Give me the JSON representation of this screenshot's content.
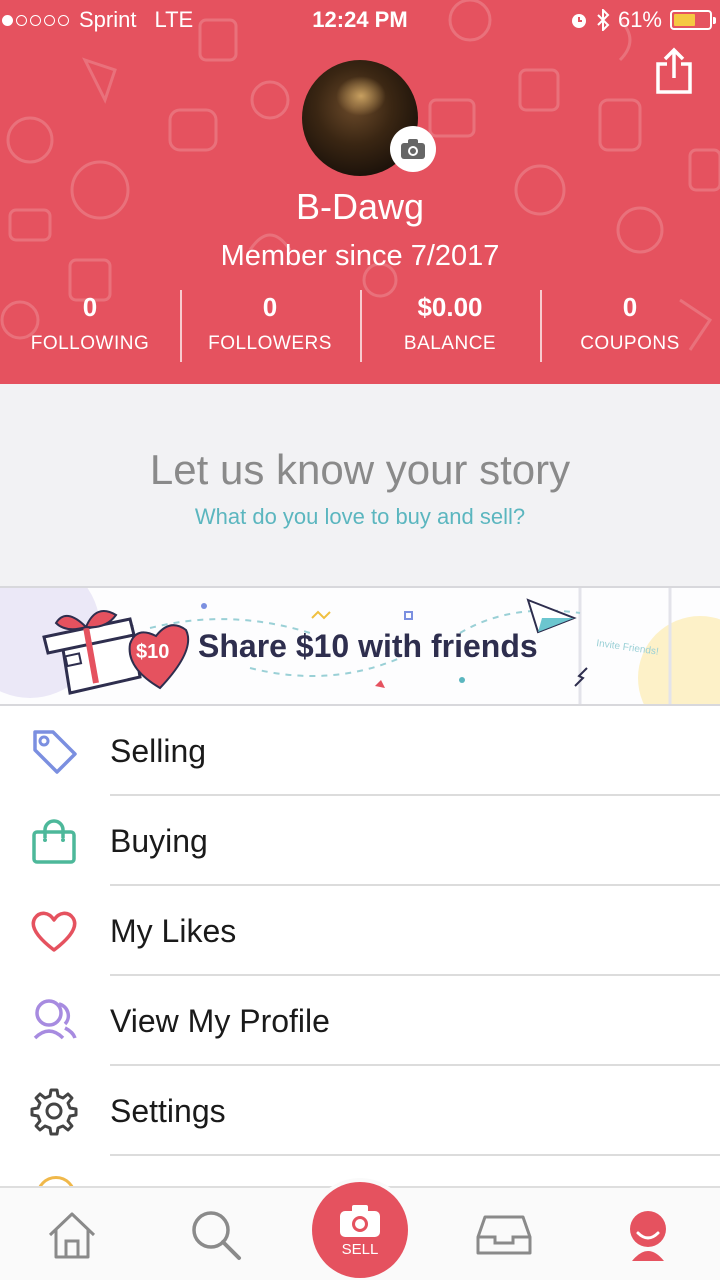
{
  "status_bar": {
    "carrier": "Sprint",
    "network": "LTE",
    "time": "12:24 PM",
    "battery": "61%",
    "battery_level": 0.61,
    "signal_bars": 1
  },
  "profile": {
    "username": "B-Dawg",
    "member_since": "Member since 7/2017",
    "stats": [
      {
        "value": "0",
        "label": "FOLLOWING"
      },
      {
        "value": "0",
        "label": "FOLLOWERS"
      },
      {
        "value": "$0.00",
        "label": "BALANCE"
      },
      {
        "value": "0",
        "label": "COUPONS"
      }
    ]
  },
  "story": {
    "title": "Let us know your story",
    "subtitle": "What do you love to buy and sell?"
  },
  "banner": {
    "badge": "$10",
    "text": "Share $10 with friends",
    "phone_text": "Invite Friends!"
  },
  "menu": {
    "items": [
      {
        "label": "Selling",
        "icon": "tag-icon"
      },
      {
        "label": "Buying",
        "icon": "shopping-bag-icon"
      },
      {
        "label": "My Likes",
        "icon": "heart-icon"
      },
      {
        "label": "View My Profile",
        "icon": "profile-icon"
      },
      {
        "label": "Settings",
        "icon": "gear-icon"
      }
    ]
  },
  "tab_bar": {
    "sell_label": "SELL"
  },
  "colors": {
    "brand": "#e5525f",
    "link": "#5bb6bf",
    "tag": "#7b8fe0",
    "bag": "#4db89a",
    "heart": "#e5525f",
    "profile": "#a78be0"
  }
}
